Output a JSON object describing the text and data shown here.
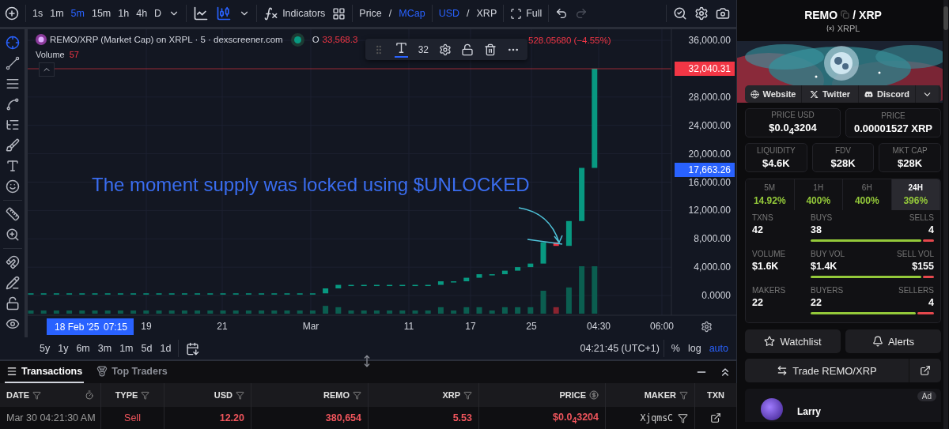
{
  "toolbar": {
    "intervals": [
      {
        "label": "1s",
        "selected": false
      },
      {
        "label": "1m",
        "selected": false
      },
      {
        "label": "5m",
        "selected": true
      },
      {
        "label": "15m",
        "selected": false
      },
      {
        "label": "1h",
        "selected": false
      },
      {
        "label": "4h",
        "selected": false
      },
      {
        "label": "D",
        "selected": false
      }
    ],
    "chart_styles": [
      {
        "kind": "line",
        "selected": false
      },
      {
        "kind": "candles",
        "selected": true
      }
    ],
    "indicators": "Indicators",
    "price_toggle": {
      "separator": "/",
      "options": [
        {
          "label": "Price",
          "selected": false
        },
        {
          "label": "MCap",
          "selected": true
        }
      ]
    },
    "currency_toggle": {
      "separator": "/",
      "options": [
        {
          "label": "USD",
          "selected": true
        },
        {
          "label": "XRP",
          "selected": false
        }
      ]
    },
    "full": "Full",
    "redo_disabled": true
  },
  "drawing_tools": [
    {
      "kind": "crosshair",
      "selected": true
    },
    {
      "kind": "line",
      "selected": false
    },
    {
      "kind": "hlines",
      "selected": false
    },
    {
      "kind": "pattern",
      "selected": false
    },
    {
      "kind": "fib",
      "selected": false
    },
    {
      "kind": "brush",
      "selected": false
    },
    {
      "kind": "text",
      "selected": false
    },
    {
      "kind": "emoji",
      "selected": false
    },
    {
      "kind": "divider"
    },
    {
      "kind": "ruler",
      "selected": false
    },
    {
      "kind": "zoom",
      "selected": false
    },
    {
      "kind": "divider"
    },
    {
      "kind": "magnet",
      "selected": false
    },
    {
      "kind": "pencil-lock",
      "selected": false
    },
    {
      "kind": "lock",
      "selected": false
    },
    {
      "kind": "eye",
      "selected": false
    }
  ],
  "legend": {
    "title": "REMO/XRP (Market Cap) on XRPL · 5 · dexscreener.com",
    "open_label": "O",
    "open_value": "33,568.3",
    "change": "528.05680 (−4.55%)",
    "volume_label": "Volume",
    "volume_value": "57"
  },
  "text_tool": {
    "size": "32"
  },
  "annotation": "The moment supply was locked using $UNLOCKED",
  "chart": {
    "price_labels": [
      "36,000.00",
      "28,000.00",
      "24,000.00",
      "20,000.00",
      "16,000.00",
      "12,000.00",
      "8,000.00",
      "4,000.00",
      "0.0000"
    ],
    "time_labels": [
      "19",
      "21",
      "Mar",
      "11",
      "17",
      "25",
      "04:30",
      "06:00"
    ],
    "last_price": "32,040.31",
    "cursor_value": "17,663.26",
    "cursor_date": "18 Feb '25",
    "cursor_time": "07:15"
  },
  "ranges": [
    "5y",
    "1y",
    "6m",
    "3m",
    "1m",
    "5d",
    "1d"
  ],
  "clock": "04:21:45 (UTC+1)",
  "scale_options": [
    {
      "label": "%",
      "selected": false
    },
    {
      "label": "log",
      "selected": false
    },
    {
      "label": "auto",
      "selected": true
    }
  ],
  "bottom_tabs": [
    {
      "label": "Transactions",
      "selected": true
    },
    {
      "label": "Top Traders",
      "selected": false
    }
  ],
  "table": {
    "columns": [
      "DATE",
      "TYPE",
      "USD",
      "REMO",
      "XRP",
      "PRICE",
      "MAKER",
      "TXN"
    ],
    "rows": [
      {
        "kind": "sell",
        "date": "Mar 30 04:21:30 AM",
        "type": "Sell",
        "usd": "12.20",
        "remo": "380,654",
        "xrp": "5.53",
        "price": "$0.0$_{4}$3204",
        "maker": "XjqmsC"
      }
    ]
  },
  "pair": {
    "base": "REMO",
    "separator": "/",
    "quote": "XRP",
    "chain": "XRPL"
  },
  "links": [
    {
      "kind": "website",
      "label": "Website"
    },
    {
      "kind": "twitter",
      "label": "Twitter"
    },
    {
      "kind": "discord",
      "label": "Discord"
    }
  ],
  "prices": [
    {
      "label": "PRICE USD",
      "value": "$0.0$_{4}$3204"
    },
    {
      "label": "PRICE",
      "value": "0.00001527 XRP"
    }
  ],
  "metrics": [
    {
      "label": "LIQUIDITY",
      "value": "$4.6K"
    },
    {
      "label": "FDV",
      "value": "$28K"
    },
    {
      "label": "MKT CAP",
      "value": "$28K"
    }
  ],
  "periods": [
    {
      "label": "5M",
      "change": "14.92%",
      "selected": false
    },
    {
      "label": "1H",
      "change": "400%",
      "selected": false
    },
    {
      "label": "6H",
      "change": "400%",
      "selected": false
    },
    {
      "label": "24H",
      "change": "396%",
      "selected": true
    }
  ],
  "stats": [
    {
      "label": "TXNS",
      "value": "42",
      "left_label": "BUYS",
      "left_value": "38",
      "right_label": "SELLS",
      "right_value": "4",
      "level": 0.9
    },
    {
      "label": "VOLUME",
      "value": "$1.6K",
      "left_label": "BUY VOL",
      "left_value": "$1.4K",
      "right_label": "SELL VOL",
      "right_value": "$155",
      "level": 0.9
    },
    {
      "label": "MAKERS",
      "value": "22",
      "left_label": "BUYERS",
      "left_value": "22",
      "right_label": "SELLERS",
      "right_value": "4",
      "level": 0.85
    }
  ],
  "actions": [
    {
      "kind": "watchlist",
      "label": "Watchlist"
    },
    {
      "kind": "alerts",
      "label": "Alerts"
    }
  ],
  "trade": "Trade REMO/XRP",
  "ad": {
    "badge": "Ad",
    "name": "Larry"
  }
}
